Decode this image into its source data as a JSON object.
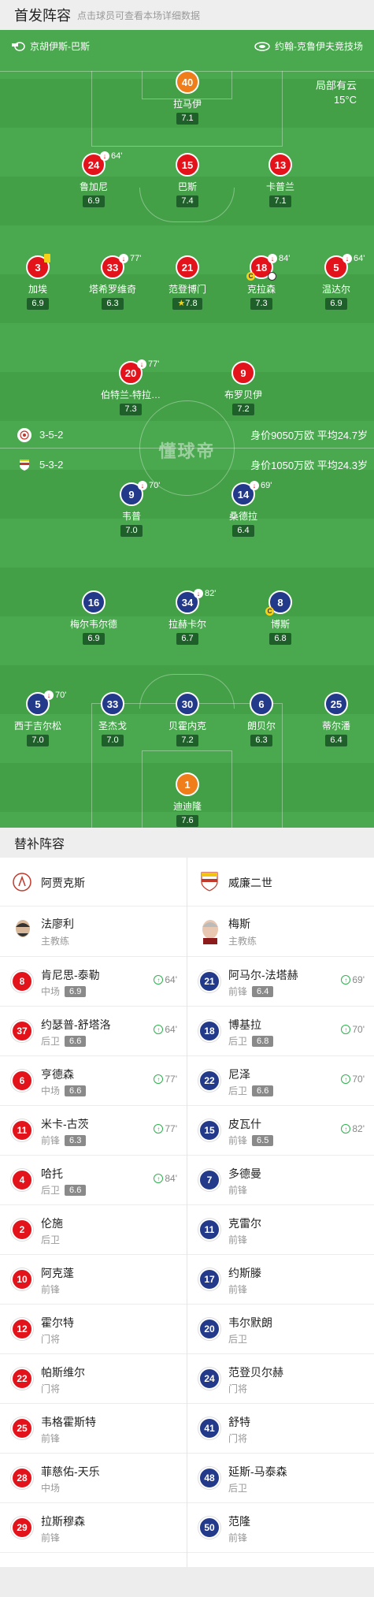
{
  "header": {
    "title": "首发阵容",
    "subtitle": "点击球员可查看本场详细数据"
  },
  "venue": {
    "referee": "京胡伊斯-巴斯",
    "stadium": "约翰-克鲁伊夫竞技场"
  },
  "weather": {
    "condition": "局部有云",
    "temp": "15°C"
  },
  "home_team": {
    "formation": "3-5-2",
    "value": "身价9050万欧",
    "avg_age": "平均24.7岁",
    "players": [
      {
        "num": "40",
        "name": "拉马伊",
        "rating": "7.1"
      },
      {
        "num": "24",
        "name": "鲁加尼",
        "rating": "6.9",
        "sub": "64'"
      },
      {
        "num": "15",
        "name": "巴斯",
        "rating": "7.4"
      },
      {
        "num": "13",
        "name": "卡普兰",
        "rating": "7.1"
      },
      {
        "num": "3",
        "name": "加埃",
        "rating": "6.9"
      },
      {
        "num": "33",
        "name": "塔希罗维奇",
        "rating": "6.3",
        "sub": "77'"
      },
      {
        "num": "21",
        "name": "范登博门",
        "rating": "7.8"
      },
      {
        "num": "18",
        "name": "克拉森",
        "rating": "7.3",
        "sub": "84'"
      },
      {
        "num": "5",
        "name": "温达尔",
        "rating": "6.9",
        "sub": "64'"
      },
      {
        "num": "20",
        "name": "伯特兰-特拉…",
        "rating": "7.3",
        "sub": "77'"
      },
      {
        "num": "9",
        "name": "布罗贝伊",
        "rating": "7.2"
      }
    ]
  },
  "away_team": {
    "formation": "5-3-2",
    "value": "身价1050万欧",
    "avg_age": "平均24.3岁",
    "players": [
      {
        "num": "9",
        "name": "韦普",
        "rating": "7.0",
        "sub": "70'"
      },
      {
        "num": "14",
        "name": "桑德拉",
        "rating": "6.4",
        "sub": "69'"
      },
      {
        "num": "16",
        "name": "梅尔韦尔德",
        "rating": "6.9"
      },
      {
        "num": "34",
        "name": "拉赫卡尔",
        "rating": "6.7",
        "sub": "82'"
      },
      {
        "num": "8",
        "name": "博斯",
        "rating": "6.8"
      },
      {
        "num": "5",
        "name": "西于吉尔松",
        "rating": "7.0",
        "sub": "70'"
      },
      {
        "num": "33",
        "name": "圣杰戈",
        "rating": "7.0"
      },
      {
        "num": "30",
        "name": "贝霍内克",
        "rating": "7.2"
      },
      {
        "num": "6",
        "name": "朗贝尔",
        "rating": "6.3"
      },
      {
        "num": "25",
        "name": "蒂尔潘",
        "rating": "6.4"
      },
      {
        "num": "1",
        "name": "迪迪隆",
        "rating": "7.6"
      }
    ]
  },
  "watermark": "懂球帝",
  "bench": {
    "title": "替补阵容",
    "home": {
      "team_name": "阿贾克斯",
      "coach": {
        "name": "法廖利",
        "role": "主教练"
      },
      "subs": [
        {
          "num": "8",
          "name": "肯尼思-泰勒",
          "pos": "中场",
          "rating": "6.9",
          "time": "64'"
        },
        {
          "num": "37",
          "name": "约瑟普-舒塔洛",
          "pos": "后卫",
          "rating": "6.6",
          "time": "64'"
        },
        {
          "num": "6",
          "name": "亨德森",
          "pos": "中场",
          "rating": "6.6",
          "time": "77'"
        },
        {
          "num": "11",
          "name": "米卡-古茨",
          "pos": "前锋",
          "rating": "6.3",
          "time": "77'"
        },
        {
          "num": "4",
          "name": "哈托",
          "pos": "后卫",
          "rating": "6.6",
          "time": "84'"
        },
        {
          "num": "2",
          "name": "伦施",
          "pos": "后卫"
        },
        {
          "num": "10",
          "name": "阿克蓬",
          "pos": "前锋"
        },
        {
          "num": "12",
          "name": "霍尔特",
          "pos": "门将"
        },
        {
          "num": "22",
          "name": "帕斯维尔",
          "pos": "门将"
        },
        {
          "num": "25",
          "name": "韦格霍斯特",
          "pos": "前锋"
        },
        {
          "num": "28",
          "name": "菲慈佑-天乐",
          "pos": "中场"
        },
        {
          "num": "29",
          "name": "拉斯穆森",
          "pos": "前锋"
        }
      ]
    },
    "away": {
      "team_name": "威廉二世",
      "coach": {
        "name": "梅斯",
        "role": "主教练"
      },
      "subs": [
        {
          "num": "21",
          "name": "阿马尔-法塔赫",
          "pos": "前锋",
          "rating": "6.4",
          "time": "69'"
        },
        {
          "num": "18",
          "name": "博基拉",
          "pos": "后卫",
          "rating": "6.8",
          "time": "70'"
        },
        {
          "num": "22",
          "name": "尼泽",
          "pos": "后卫",
          "rating": "6.6",
          "time": "70'"
        },
        {
          "num": "15",
          "name": "皮瓦什",
          "pos": "前锋",
          "rating": "6.5",
          "time": "82'"
        },
        {
          "num": "7",
          "name": "多德曼",
          "pos": "前锋"
        },
        {
          "num": "11",
          "name": "克雷尔",
          "pos": "前锋"
        },
        {
          "num": "17",
          "name": "约斯滕",
          "pos": "前锋"
        },
        {
          "num": "20",
          "name": "韦尔默朗",
          "pos": "后卫"
        },
        {
          "num": "24",
          "name": "范登贝尔赫",
          "pos": "门将"
        },
        {
          "num": "41",
          "name": "舒特",
          "pos": "门将"
        },
        {
          "num": "48",
          "name": "延斯-马泰森",
          "pos": "后卫"
        },
        {
          "num": "50",
          "name": "范隆",
          "pos": "前锋"
        }
      ]
    }
  },
  "colors": {
    "pitch": "#43a047",
    "home": "#e3131b",
    "away": "#233a8a",
    "keeper": "#ef7d1a"
  }
}
